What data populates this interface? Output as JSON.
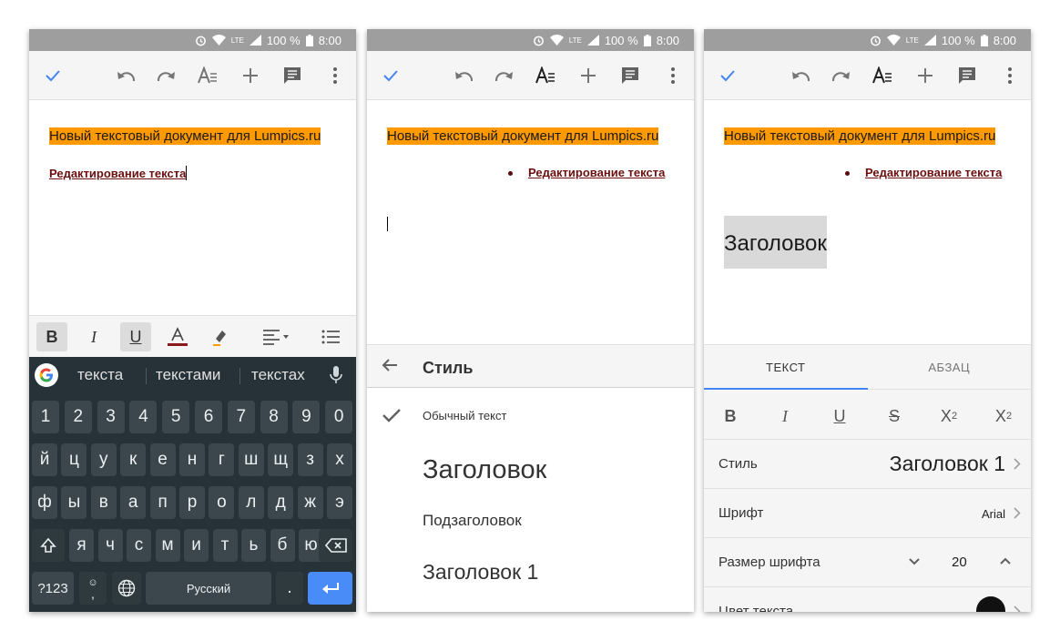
{
  "status": {
    "battery": "100 %",
    "time": "8:00",
    "network": "LTE"
  },
  "document": {
    "title_line": "Новый текстовый документ для Lumpics.ru",
    "subheading": "Редактирование текста",
    "heading_text": "Заголовок"
  },
  "keyboard": {
    "suggestions": [
      "текста",
      "текстами",
      "текстах"
    ],
    "row_digits": [
      "1",
      "2",
      "3",
      "4",
      "5",
      "6",
      "7",
      "8",
      "9",
      "0"
    ],
    "row1": [
      "й",
      "ц",
      "у",
      "к",
      "е",
      "н",
      "г",
      "ш",
      "щ",
      "з",
      "х"
    ],
    "row2": [
      "ф",
      "ы",
      "в",
      "а",
      "п",
      "р",
      "о",
      "л",
      "д",
      "ж",
      "э"
    ],
    "row3": [
      "я",
      "ч",
      "с",
      "м",
      "и",
      "т",
      "ь",
      "б",
      "ю"
    ],
    "sym_label": "?123",
    "emoji_comma": ",",
    "space_label": "Русский",
    "period": "."
  },
  "style_panel": {
    "title": "Стиль",
    "options": [
      "Обычный текст",
      "Заголовок",
      "Подзаголовок",
      "Заголовок 1"
    ],
    "selected": "Обычный текст"
  },
  "format_panel": {
    "tabs": [
      "ТЕКСТ",
      "АБЗАЦ"
    ],
    "active_tab": "ТЕКСТ",
    "rows": {
      "style_label": "Стиль",
      "style_value": "Заголовок 1",
      "font_label": "Шрифт",
      "font_value": "Arial",
      "size_label": "Размер шрифта",
      "size_value": "20",
      "color_label": "Цвет текста"
    }
  },
  "colors": {
    "accent": "#4285f4",
    "highlight": "#ff9900",
    "subheading": "#6b0f0f",
    "keyboard_bg": "#263238",
    "enter_key": "#4a8cf7"
  },
  "icons": [
    "check-icon",
    "undo-icon",
    "redo-icon",
    "text-format-icon",
    "insert-icon",
    "comment-icon",
    "more-icon",
    "arrow-back-icon",
    "globe-icon",
    "backspace-icon",
    "shift-icon",
    "mic-icon",
    "google-g-icon",
    "chevron-right-icon",
    "chevron-down-icon",
    "chevron-up-icon"
  ]
}
